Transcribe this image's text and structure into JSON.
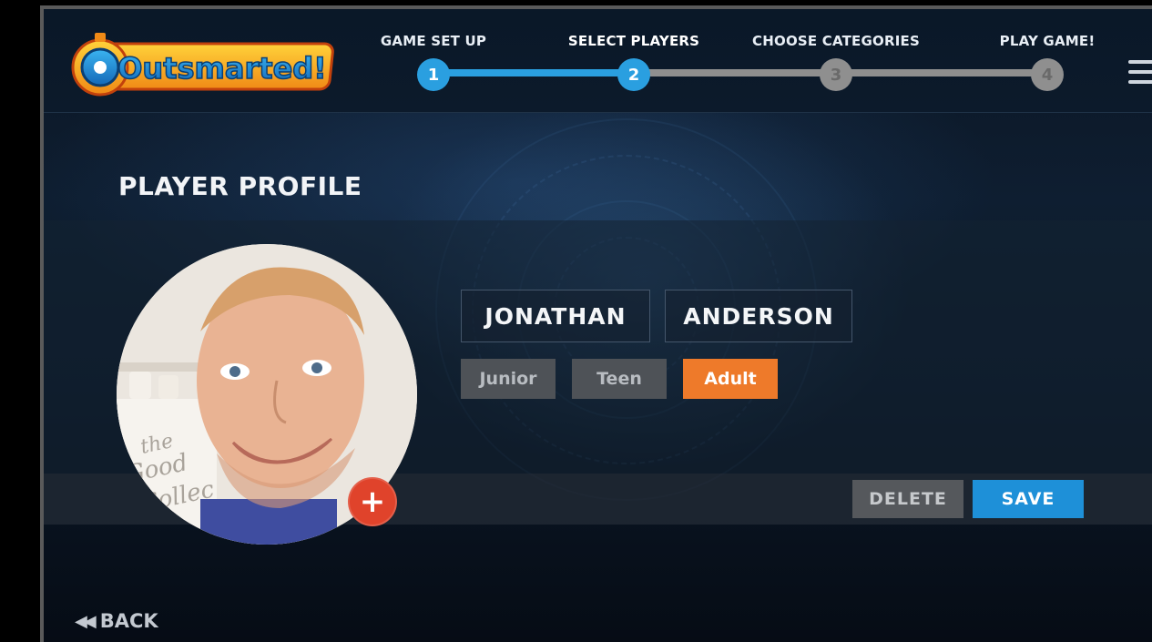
{
  "app": {
    "logo_text": "Outsmarted!"
  },
  "steps": [
    {
      "number": "1",
      "label": "GAME SET UP",
      "state": "done"
    },
    {
      "number": "2",
      "label": "SELECT PLAYERS",
      "state": "current"
    },
    {
      "number": "3",
      "label": "CHOOSE CATEGORIES",
      "state": "todo"
    },
    {
      "number": "4",
      "label": "PLAY GAME!",
      "state": "todo"
    }
  ],
  "page": {
    "title": "PLAYER PROFILE"
  },
  "profile": {
    "first_name": "JONATHAN",
    "last_name": "ANDERSON",
    "age_groups": [
      "Junior",
      "Teen",
      "Adult"
    ],
    "selected_age_group": "Adult",
    "add_photo_label": "+",
    "photo_mug_text": "the Good Collec"
  },
  "actions": {
    "delete_label": "DELETE",
    "save_label": "SAVE"
  },
  "nav": {
    "back_label": "BACK",
    "back_icon": "◀◀"
  },
  "colors": {
    "step_done": "#2a9fe0",
    "step_todo": "#8f8f8f",
    "selected_age": "#ee7a2a",
    "save": "#1e90d8",
    "add_photo": "#e0432b"
  }
}
